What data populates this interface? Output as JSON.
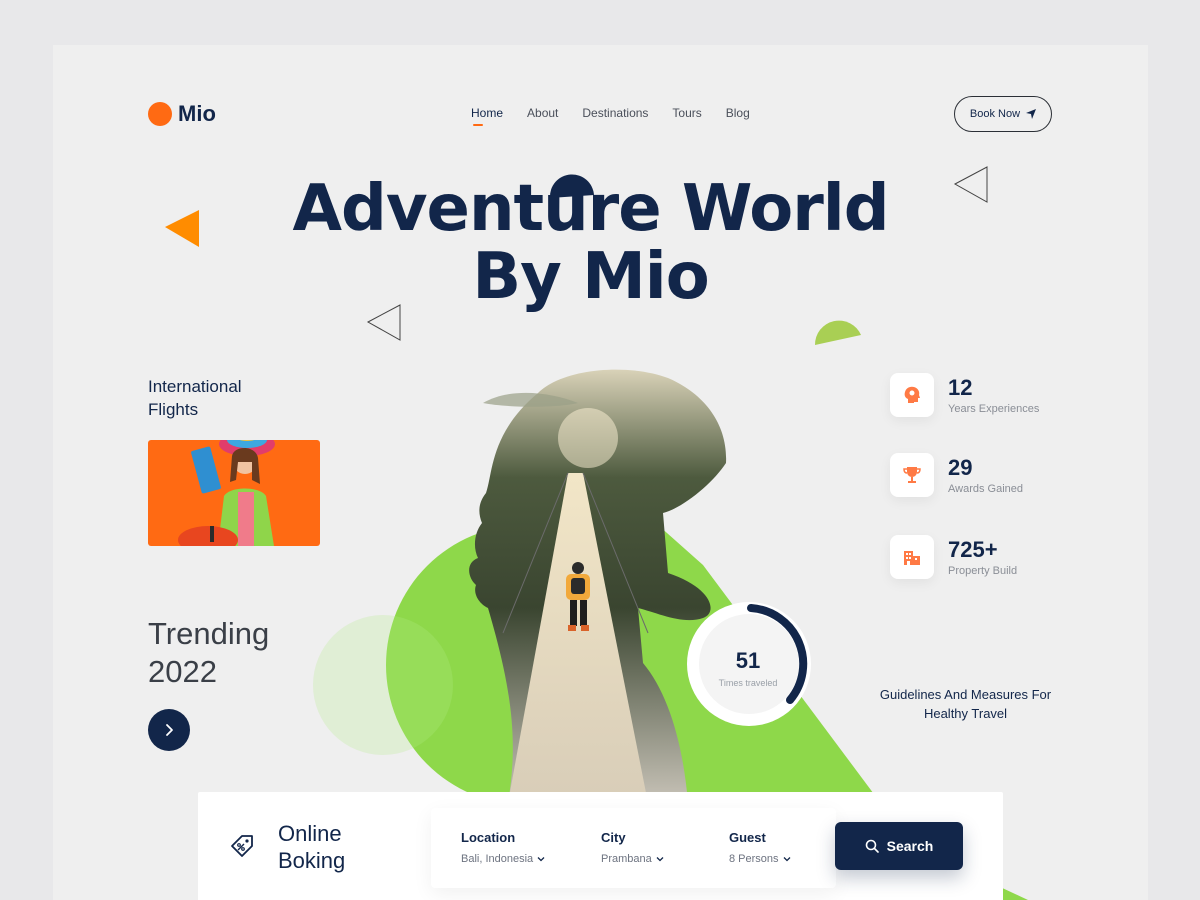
{
  "brand": {
    "name": "Mio",
    "accent": "#ff6a13",
    "navy": "#12264a",
    "green": "#8ed84a"
  },
  "nav": {
    "items": [
      {
        "label": "Home",
        "active": true
      },
      {
        "label": "About"
      },
      {
        "label": "Destinations"
      },
      {
        "label": "Tours"
      },
      {
        "label": "Blog"
      }
    ],
    "cta": {
      "label": "Book Now",
      "icon": "send-icon"
    }
  },
  "hero": {
    "line1": "Adventure World",
    "line2": "By Mio"
  },
  "left": {
    "intl_line1": "International",
    "intl_line2": "Flights",
    "trending_line1": "Trending",
    "trending_line2": "2022",
    "next_icon": "chevron-right-icon"
  },
  "stats": [
    {
      "value": "12",
      "label": "Years Experiences",
      "icon": "idea-head-icon"
    },
    {
      "value": "29",
      "label": "Awards Gained",
      "icon": "trophy-icon"
    },
    {
      "value": "725+",
      "label": "Property Build",
      "icon": "building-icon"
    }
  ],
  "ring": {
    "value": "51",
    "label": "Times traveled"
  },
  "guidelines": {
    "line1": "Guidelines And Measures For",
    "line2": "Healthy Travel"
  },
  "booking": {
    "title_line1": "Online",
    "title_line2": "Boking",
    "icon": "discount-tag-icon",
    "fields": [
      {
        "label": "Location",
        "value": "Bali, Indonesia"
      },
      {
        "label": "City",
        "value": "Prambana"
      },
      {
        "label": "Guest",
        "value": "8 Persons"
      }
    ],
    "search_label": "Search"
  }
}
